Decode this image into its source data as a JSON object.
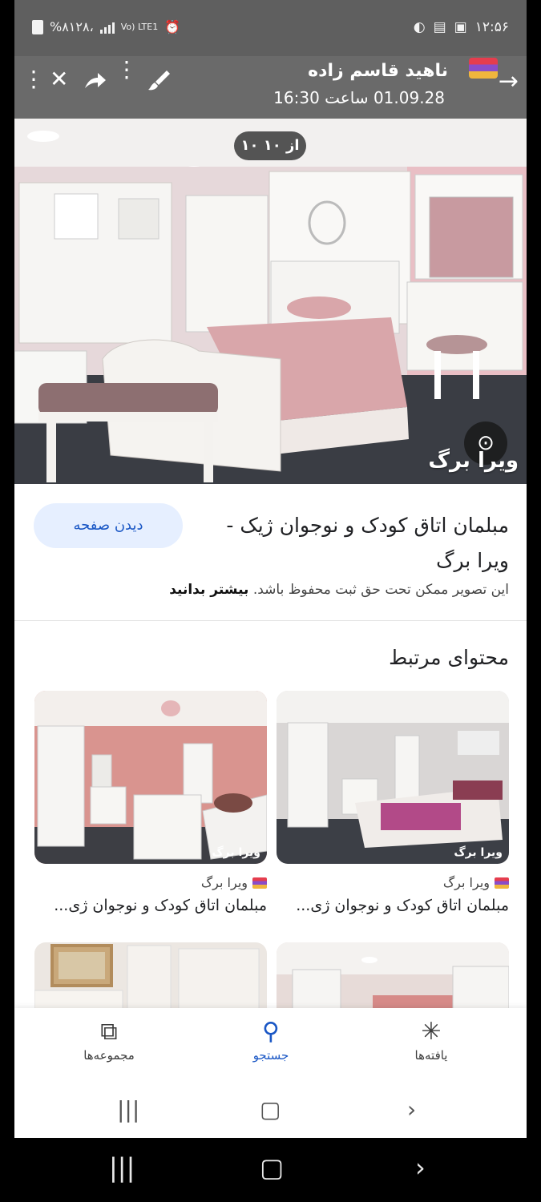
{
  "status": {
    "left": "%٨١٢٨،",
    "network": "Vo) LTE1",
    "time": "۱۲:۵۶"
  },
  "viewer": {
    "title": "ناهید قاسم زاده",
    "date": "01.09.28 ساعت 16:30"
  },
  "image": {
    "counter": "۱۰ از ۱۰",
    "watermark": "ویرا برگ"
  },
  "result": {
    "title": "مبلمان اتاق کودک و نوجوان ژیک - ویرا برگ",
    "visit_label": "دیدن صفحه",
    "copyright_text": "این تصویر ممکن تحت حق ثبت محفوظ باشد.",
    "learn_more": "بیشتر بدانید"
  },
  "related": {
    "heading": "محتوای مرتبط",
    "cards": [
      {
        "source": "ویرا برگ",
        "title": "مبلمان اتاق کودک و نوجوان ژی...",
        "watermark": "ویرا برگ"
      },
      {
        "source": "ویرا برگ",
        "title": "مبلمان اتاق کودک و نوجوان ژی...",
        "watermark": "ویرا برگ"
      }
    ]
  },
  "nav": {
    "collections": "مجموعه‌ها",
    "search": "جستجو",
    "findings": "یافته‌ها"
  },
  "colors": {
    "accent": "#1a57c5",
    "chip_bg": "#e6efff"
  }
}
